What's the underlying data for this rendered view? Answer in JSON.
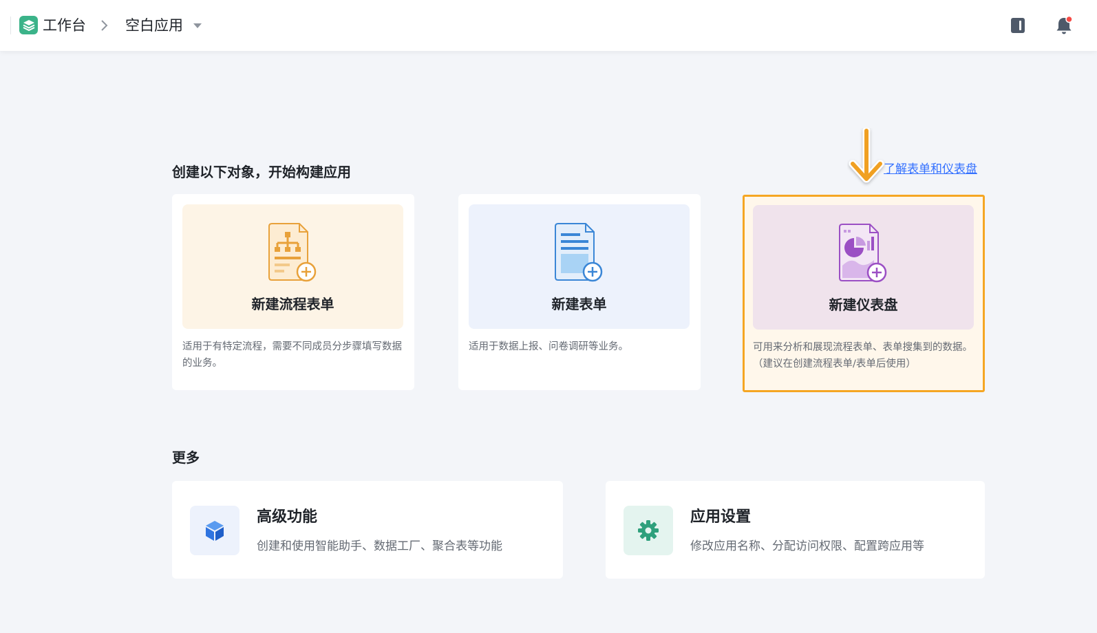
{
  "breadcrumb": {
    "home": "工作台",
    "app": "空白应用"
  },
  "topbar_icons": {
    "book": "book-icon",
    "bell": "notification-bell-icon"
  },
  "create_section": {
    "title": "创建以下对象，开始构建应用",
    "help_link": "了解表单和仪表盘",
    "cards": [
      {
        "label": "新建流程表单",
        "desc": "适用于有特定流程，需要不同成员分步骤填写数据的业务。",
        "icon": "flow-form-icon",
        "banner_color": "#fdf4e6",
        "accent": "#e8a13a"
      },
      {
        "label": "新建表单",
        "desc": "适用于数据上报、问卷调研等业务。",
        "icon": "form-icon",
        "banner_color": "#edf2fc",
        "accent": "#3a86d6"
      },
      {
        "label": "新建仪表盘",
        "desc": "可用来分析和展现流程表单、表单搜集到的数据。（建议在创建流程表单/表单后使用）",
        "icon": "dashboard-icon",
        "banner_color": "#f0e3ec",
        "accent": "#9b4fc4"
      }
    ]
  },
  "more_section": {
    "title": "更多",
    "items": [
      {
        "title": "高级功能",
        "desc": "创建和使用智能助手、数据工厂、聚合表等功能",
        "icon": "cube-icon"
      },
      {
        "title": "应用设置",
        "desc": "修改应用名称、分配访问权限、配置跨应用等",
        "icon": "gear-icon"
      }
    ]
  },
  "colors": {
    "highlight_border": "#f5a623",
    "arrow": "#f0a020",
    "link": "#3370ff"
  }
}
